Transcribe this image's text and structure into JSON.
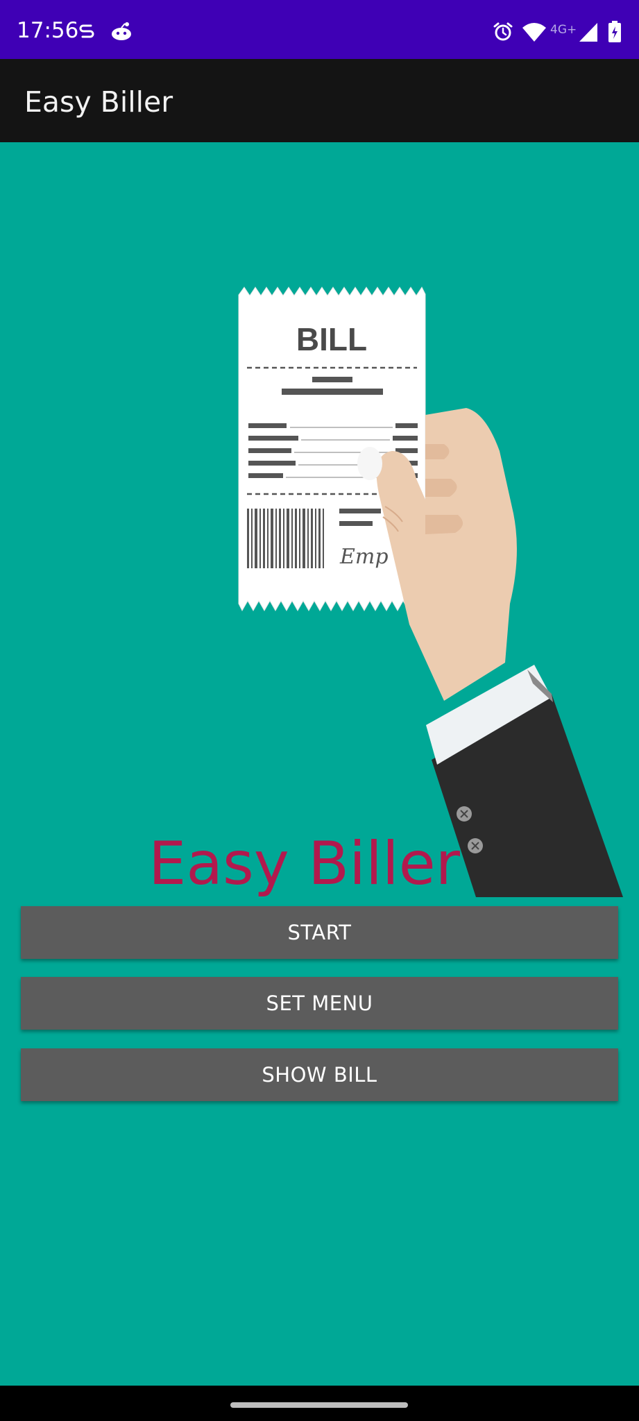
{
  "status_bar": {
    "time": "17:56",
    "left_icons": [
      "s-icon",
      "reddit-icon"
    ],
    "right_icons": [
      "alarm-icon",
      "wifi-icon",
      "signal-icon",
      "battery-icon"
    ],
    "network_label": "4G+",
    "background": "#3f00b5"
  },
  "app_bar": {
    "title": "Easy Biller",
    "background": "#141414"
  },
  "main": {
    "background": "#00a896",
    "illustration": {
      "bill_heading": "BILL",
      "signature": "Emp"
    },
    "hero_title": "Easy Biller",
    "hero_title_color": "#b2194d",
    "buttons": [
      {
        "label": "START"
      },
      {
        "label": "SET MENU"
      },
      {
        "label": "SHOW BILL"
      }
    ]
  }
}
